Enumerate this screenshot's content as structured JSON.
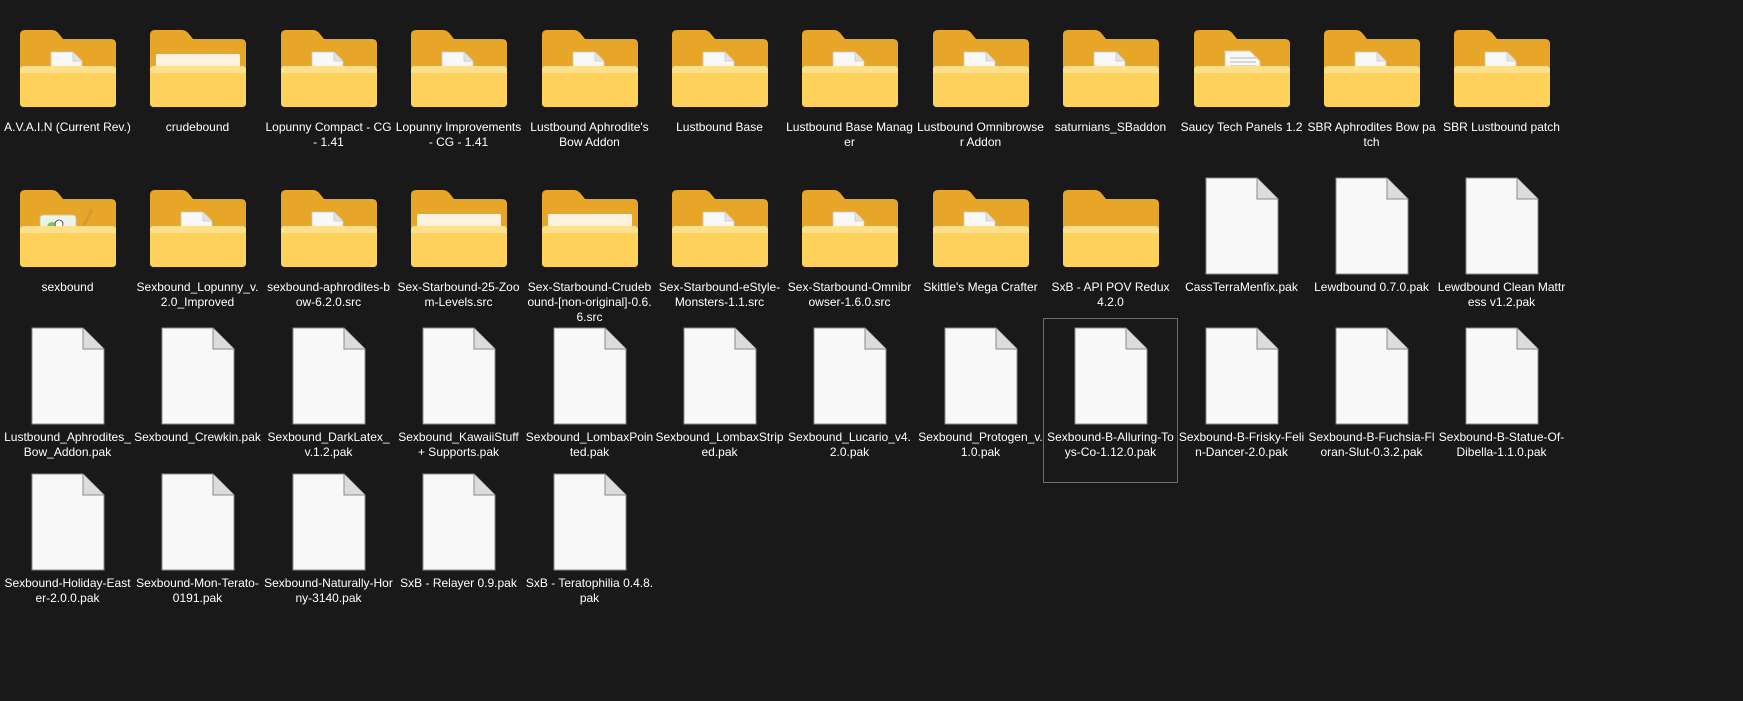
{
  "view": {
    "selected_index": 32
  },
  "colors": {
    "background": "#191919",
    "text": "#ffffff",
    "folder_back": "#e8a628",
    "folder_front": "#ffd35b",
    "paper": "#f8f8f8",
    "selection_border": "#6d6d6d"
  },
  "items": [
    {
      "name": "A.V.A.I.N (Current Rev.)",
      "icon": "folder-with-document-icon"
    },
    {
      "name": "crudebound",
      "icon": "folder-icon"
    },
    {
      "name": "Lopunny Compact - CG - 1.41",
      "icon": "folder-with-document-icon"
    },
    {
      "name": "Lopunny Improvements - CG - 1.41",
      "icon": "folder-with-document-icon"
    },
    {
      "name": "Lustbound Aphrodite's Bow Addon",
      "icon": "folder-with-document-icon"
    },
    {
      "name": "Lustbound Base",
      "icon": "folder-with-document-icon"
    },
    {
      "name": "Lustbound Base Manager",
      "icon": "folder-with-document-icon"
    },
    {
      "name": "Lustbound Omnibrowser Addon",
      "icon": "folder-with-document-icon"
    },
    {
      "name": "saturnians_SBaddon",
      "icon": "folder-with-document-icon"
    },
    {
      "name": "Saucy Tech Panels 1.2",
      "icon": "folder-with-text-document-icon"
    },
    {
      "name": "SBR Aphrodites Bow patch",
      "icon": "folder-with-document-icon"
    },
    {
      "name": "SBR Lustbound patch",
      "icon": "folder-with-document-icon"
    },
    {
      "name": "sexbound",
      "icon": "folder-with-notepad-icon"
    },
    {
      "name": "Sexbound_Lopunny_v.2.0_Improved",
      "icon": "folder-with-document-icon"
    },
    {
      "name": "sexbound-aphrodites-bow-6.2.0.src",
      "icon": "folder-with-document-icon"
    },
    {
      "name": "Sex-Starbound-25-Zoom-Levels.src",
      "icon": "folder-icon"
    },
    {
      "name": "Sex-Starbound-Crudebound-[non-original]-0.6.6.src",
      "icon": "folder-icon"
    },
    {
      "name": "Sex-Starbound-eStyle-Monsters-1.1.src",
      "icon": "folder-with-document-icon"
    },
    {
      "name": "Sex-Starbound-Omnibrowser-1.6.0.src",
      "icon": "folder-with-document-icon"
    },
    {
      "name": "Skittle's Mega Crafter",
      "icon": "folder-with-document-icon"
    },
    {
      "name": "SxB - API POV Redux 4.2.0",
      "icon": "empty-folder-icon"
    },
    {
      "name": "CassTerraMenfix.pak",
      "icon": "file-icon"
    },
    {
      "name": "Lewdbound 0.7.0.pak",
      "icon": "file-icon"
    },
    {
      "name": "Lewdbound Clean Mattress v1.2.pak",
      "icon": "file-icon"
    },
    {
      "name": "Lustbound_Aphrodites_Bow_Addon.pak",
      "icon": "file-icon"
    },
    {
      "name": "Sexbound_Crewkin.pak",
      "icon": "file-icon"
    },
    {
      "name": "Sexbound_DarkLatex_v.1.2.pak",
      "icon": "file-icon"
    },
    {
      "name": "Sexbound_KawaiiStuff + Supports.pak",
      "icon": "file-icon"
    },
    {
      "name": "Sexbound_LombaxPointed.pak",
      "icon": "file-icon"
    },
    {
      "name": "Sexbound_LombaxStriped.pak",
      "icon": "file-icon"
    },
    {
      "name": "Sexbound_Lucario_v4.2.0.pak",
      "icon": "file-icon"
    },
    {
      "name": "Sexbound_Protogen_v.1.0.pak",
      "icon": "file-icon"
    },
    {
      "name": "Sexbound-B-Alluring-Toys-Co-1.12.0.pak",
      "icon": "file-icon"
    },
    {
      "name": "Sexbound-B-Frisky-Felin-Dancer-2.0.pak",
      "icon": "file-icon"
    },
    {
      "name": "Sexbound-B-Fuchsia-Floran-Slut-0.3.2.pak",
      "icon": "file-icon"
    },
    {
      "name": "Sexbound-B-Statue-Of-Dibella-1.1.0.pak",
      "icon": "file-icon"
    },
    {
      "name": "Sexbound-Holiday-Easter-2.0.0.pak",
      "icon": "file-icon"
    },
    {
      "name": "Sexbound-Mon-Terato-0191.pak",
      "icon": "file-icon"
    },
    {
      "name": "Sexbound-Naturally-Horny-3140.pak",
      "icon": "file-icon"
    },
    {
      "name": "SxB - Relayer 0.9.pak",
      "icon": "file-icon"
    },
    {
      "name": "SxB - Teratophilia 0.4.8.pak",
      "icon": "file-icon"
    }
  ]
}
